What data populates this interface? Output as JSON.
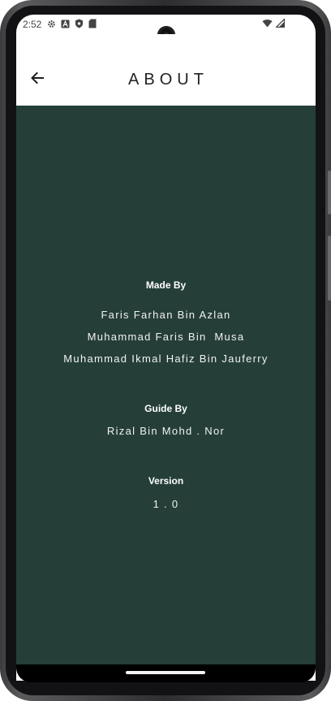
{
  "status_bar": {
    "time": "2:52",
    "left_icons": [
      "gear-icon",
      "a-badge-icon",
      "shield-icon",
      "sd-card-icon"
    ],
    "right_icons": [
      "wifi-icon",
      "signal-icon"
    ]
  },
  "app_bar": {
    "title": "ABOUT",
    "back_icon": "arrow-left-icon"
  },
  "about": {
    "made_by": {
      "heading": "Made By",
      "names": [
        "Faris Farhan Bin Azlan",
        "Muhammad Faris Bin  Musa",
        "Muhammad Ikmal Hafiz Bin Jauferry"
      ]
    },
    "guide_by": {
      "heading": "Guide By",
      "name": "Rizal Bin Mohd . Nor"
    },
    "version": {
      "heading": "Version",
      "value": "1 . 0"
    }
  },
  "colors": {
    "content_background": "#253e38",
    "app_bar_background": "#ffffff",
    "text_on_content": "#ffffff"
  }
}
